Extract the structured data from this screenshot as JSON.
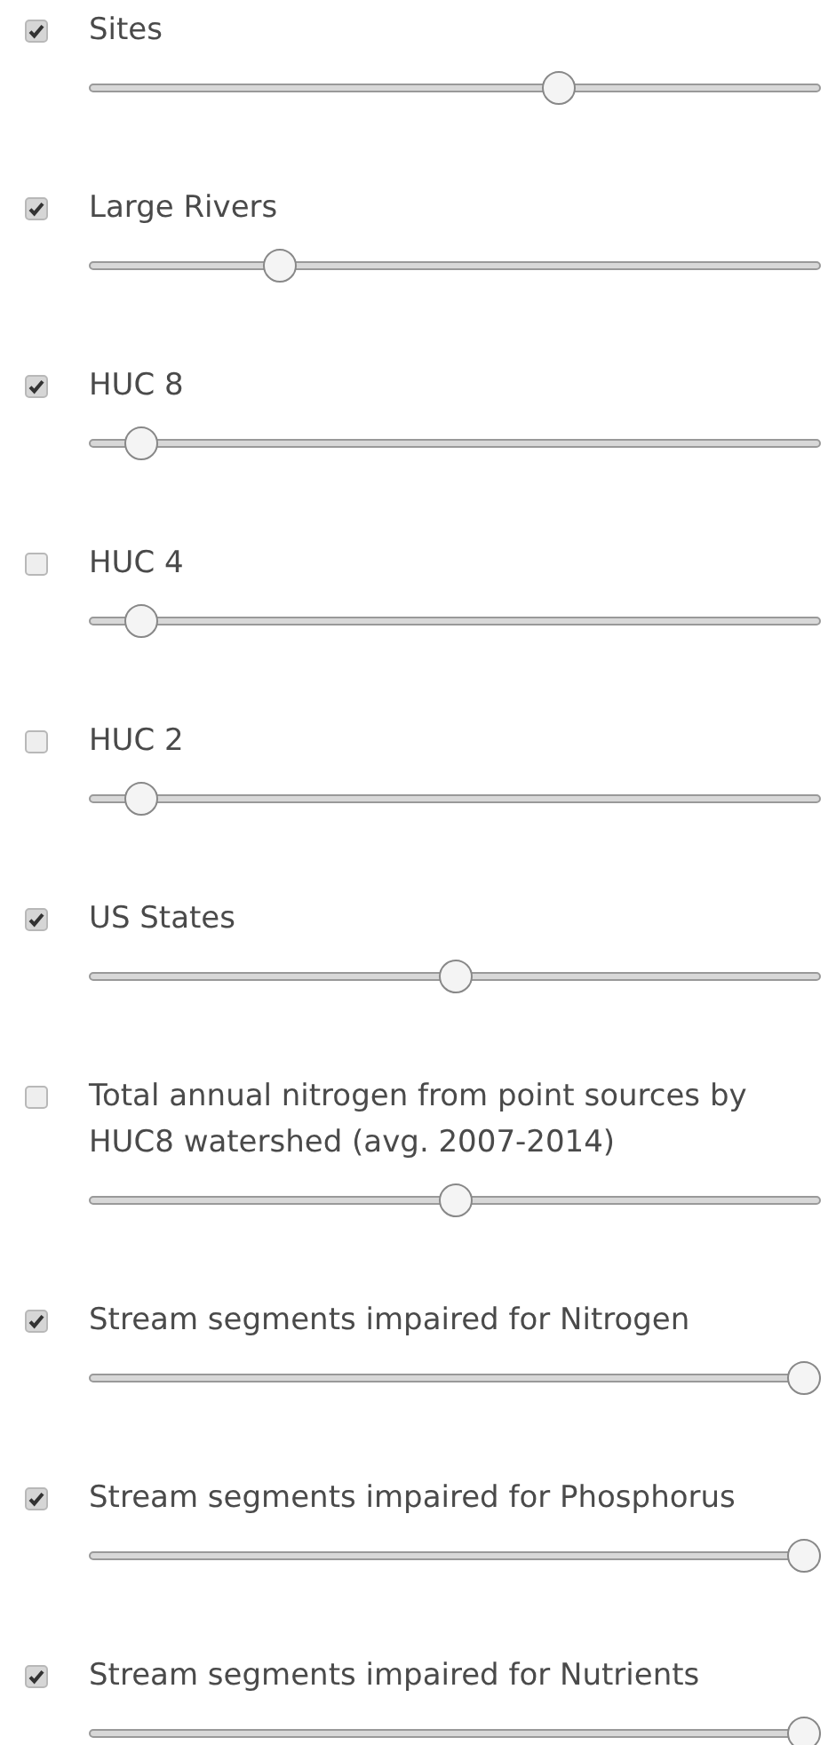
{
  "layers": [
    {
      "label": "Sites",
      "checked": true,
      "level": 0.65
    },
    {
      "label": "Large Rivers",
      "checked": true,
      "level": 0.25
    },
    {
      "label": "HUC 8",
      "checked": true,
      "level": 0.05
    },
    {
      "label": "HUC 4",
      "checked": false,
      "level": 0.05
    },
    {
      "label": "HUC 2",
      "checked": false,
      "level": 0.05
    },
    {
      "label": "US States",
      "checked": true,
      "level": 0.5
    },
    {
      "label": "Total annual nitrogen from point sources by HUC8 watershed (avg. 2007-2014)",
      "checked": false,
      "level": 0.5
    },
    {
      "label": "Stream segments impaired for Nitrogen",
      "checked": true,
      "level": 1
    },
    {
      "label": "Stream segments impaired for Phosphorus",
      "checked": true,
      "level": 1
    },
    {
      "label": "Stream segments impaired for Nutrients",
      "checked": true,
      "level": 1
    }
  ]
}
